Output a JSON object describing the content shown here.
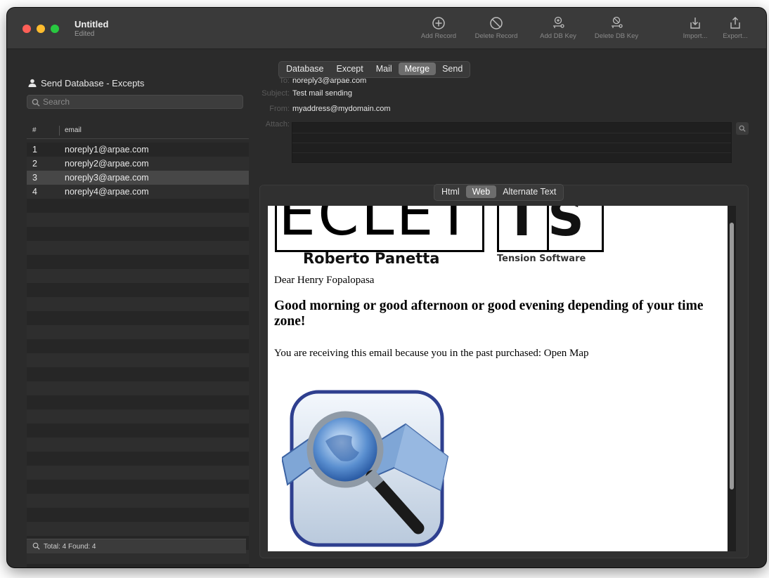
{
  "window": {
    "title": "Untitled",
    "subtitle": "Edited"
  },
  "toolbar": {
    "add_record": "Add Record",
    "delete_record": "Delete Record",
    "add_db_key": "Add DB Key",
    "delete_db_key": "Delete DB Key",
    "import": "Import...",
    "export": "Export..."
  },
  "sidebar": {
    "title": "Send Database - Excepts",
    "search_placeholder": "Search",
    "columns": [
      "#",
      "email"
    ],
    "rows": [
      {
        "num": "1",
        "email": "noreply1@arpae.com"
      },
      {
        "num": "2",
        "email": "noreply2@arpae.com"
      },
      {
        "num": "3",
        "email": "noreply3@arpae.com"
      },
      {
        "num": "4",
        "email": "noreply4@arpae.com"
      }
    ],
    "footer": "Total: 4   Found: 4"
  },
  "tabs": [
    "Database",
    "Except",
    "Mail",
    "Merge",
    "Send"
  ],
  "active_tab": "Merge",
  "mail": {
    "to_label": "To:",
    "to": "noreply3@arpae.com",
    "subject_label": "Subject:",
    "subject": "Test mail sending",
    "from_label": "From:",
    "from": "myaddress@mydomain.com",
    "attach_label": "Attach:"
  },
  "content_tabs": [
    "Html",
    "Web",
    "Alternate Text"
  ],
  "active_content_tab": "Web",
  "web": {
    "logo_left": "ECLETTI",
    "logo_left_name": "Roberto Panetta",
    "logo_right": "TS",
    "logo_right_name": "Tension Software",
    "greeting": "Dear Henry Fopalopasa",
    "headline": "Good morning or good afternoon or good evening depending of your time zone!",
    "body": "You are receiving this email because you in the past purchased: Open Map"
  }
}
